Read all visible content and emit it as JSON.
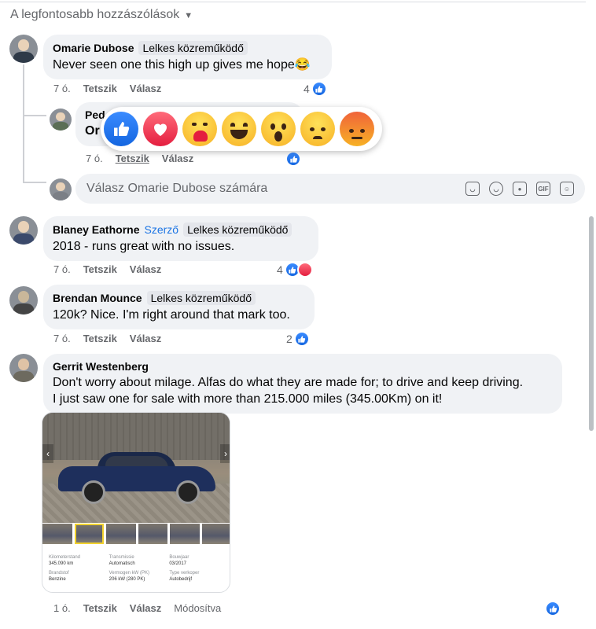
{
  "sort_label": "A legfontosabb hozzászólások",
  "comments": [
    {
      "author": "Omarie Dubose",
      "badge": "Lelkes közreműködő",
      "text": "Never seen one this high up gives me hope😂",
      "time": "7 ó.",
      "like_label": "Tetszik",
      "reply_label": "Válasz",
      "reaction_count": "4"
    },
    {
      "author": "Ped",
      "text": "Or",
      "time": "7 ó.",
      "like_label": "Tetszik",
      "reply_label": "Válasz"
    },
    {
      "author": "Blaney Eathorne",
      "author_tag": "Szerző",
      "badge": "Lelkes közreműködő",
      "text": "2018 - runs great with no issues.",
      "time": "7 ó.",
      "like_label": "Tetszik",
      "reply_label": "Válasz",
      "reaction_count": "4"
    },
    {
      "author": "Brendan Mounce",
      "badge": "Lelkes közreműködő",
      "text": "120k? Nice. I'm right around that mark too.",
      "time": "7 ó.",
      "like_label": "Tetszik",
      "reply_label": "Válasz",
      "reaction_count": "2"
    },
    {
      "author": "Gerrit Westenberg",
      "text_line1": "Don't worry about milage. Alfas do what they are made for; to drive and keep driving.",
      "text_line2": "I just saw one for sale with more than 215.000 miles (345.00Km) on it!",
      "time": "1 ó.",
      "like_label": "Tetszik",
      "reply_label": "Válasz",
      "edited_label": "Módosítva"
    }
  ],
  "reply_input": {
    "placeholder": "Válasz Omarie Dubose számára",
    "icons": [
      "sticker-icon",
      "emoji-icon",
      "camera-icon",
      "gif-icon",
      "avatar-sticker-icon"
    ],
    "gif_label": "GIF"
  },
  "reactions": [
    "like",
    "love",
    "care",
    "haha",
    "wow",
    "sad",
    "angry"
  ],
  "attachment": {
    "specs": [
      {
        "key": "Kilometerstand",
        "value": "345.090 km"
      },
      {
        "key": "Transmissie",
        "value": "Automatisch"
      },
      {
        "key": "Bouwjaar",
        "value": "03/2017"
      },
      {
        "key": "Brandstof",
        "value": "Benzine"
      },
      {
        "key": "Vermogen kW (PK)",
        "value": "206 kW (280 PK)"
      },
      {
        "key": "Type verkoper",
        "value": "Autobedrijf"
      }
    ]
  },
  "colors": {
    "accent": "#1b74e4",
    "bubble": "#f0f2f5",
    "muted_text": "#65676b"
  }
}
